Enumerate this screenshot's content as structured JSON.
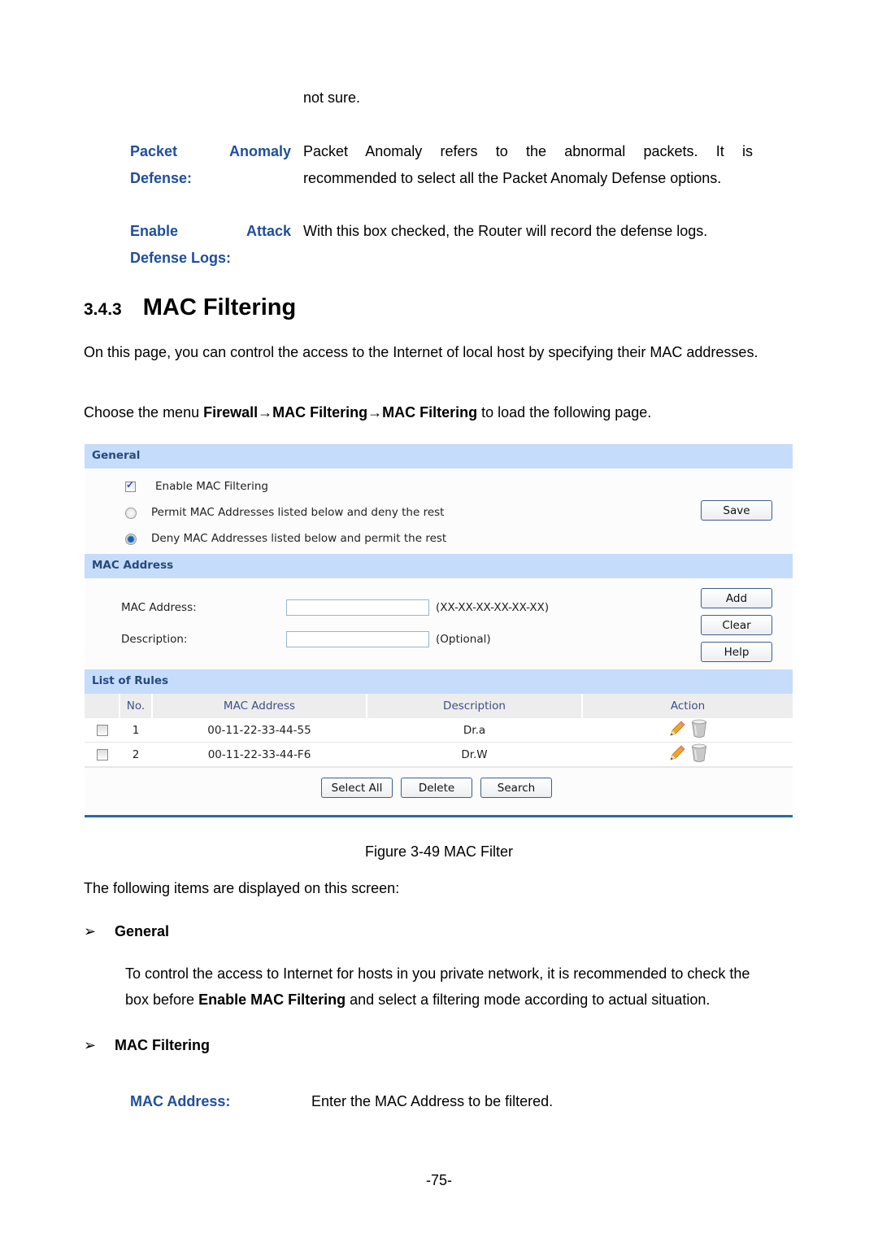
{
  "intro_fragment": "not sure.",
  "definitions_top": [
    {
      "term_words": [
        "Packet",
        "Anomaly"
      ],
      "term_second_line": "Defense:",
      "description_line1": "Packet Anomaly refers to the abnormal packets. It is",
      "description_line2": "recommended to select all the Packet Anomaly Defense options."
    },
    {
      "term_words": [
        "Enable",
        "Attack"
      ],
      "term_second_line": "Defense Logs:",
      "description_line1": "With this box checked, the Router will record the defense logs."
    }
  ],
  "section": {
    "number": "3.4.3",
    "title": "MAC Filtering",
    "intro": "On this page, you can control the access to the Internet of local host by specifying their MAC addresses.",
    "menu_prefix": "Choose the menu ",
    "menu_path": "Firewall→MAC Filtering→MAC Filtering",
    "menu_suffix": " to load the following page."
  },
  "figure": {
    "general": {
      "title": "General",
      "enable_label": "Enable MAC Filtering",
      "enable_checked": true,
      "mode_options": [
        {
          "label": "Permit MAC Addresses listed below and deny the rest",
          "selected": false
        },
        {
          "label": "Deny MAC Addresses listed below and permit the rest",
          "selected": true
        }
      ],
      "save_label": "Save"
    },
    "mac_address": {
      "title": "MAC Address",
      "mac_label": "MAC Address:",
      "mac_value": "",
      "mac_hint": "(XX-XX-XX-XX-XX-XX)",
      "desc_label": "Description:",
      "desc_value": "",
      "desc_hint": "(Optional)",
      "add_label": "Add",
      "clear_label": "Clear",
      "help_label": "Help"
    },
    "rules": {
      "title": "List of Rules",
      "columns": [
        "",
        "No.",
        "MAC Address",
        "Description",
        "Action"
      ],
      "rows": [
        {
          "no": "1",
          "mac": "00-11-22-33-44-55",
          "description": "Dr.a",
          "checked": false
        },
        {
          "no": "2",
          "mac": "00-11-22-33-44-F6",
          "description": "Dr.W",
          "checked": false
        }
      ],
      "select_all_label": "Select All",
      "delete_label": "Delete",
      "search_label": "Search"
    },
    "caption": "Figure 3-49 MAC Filter"
  },
  "after_figure": {
    "lead": "The following items are displayed on this screen:",
    "general_heading": "General",
    "general_text_1": "To control the access to Internet for hosts in you private network, it is recommended to check the",
    "general_text_2_prefix": "box before ",
    "general_text_2_bold": "Enable MAC Filtering",
    "general_text_2_suffix": " and select a filtering mode according to actual situation.",
    "mac_filtering_heading": "MAC Filtering",
    "mac_address_term": "MAC Address:",
    "mac_address_desc": "Enter the MAC Address to be filtered."
  },
  "page_number": "-75-",
  "colors": {
    "term_blue": "#1f4e9c",
    "band_blue": "#c6dcfb",
    "band_title": "#27497e",
    "figure_rule": "#2b6aa8"
  }
}
